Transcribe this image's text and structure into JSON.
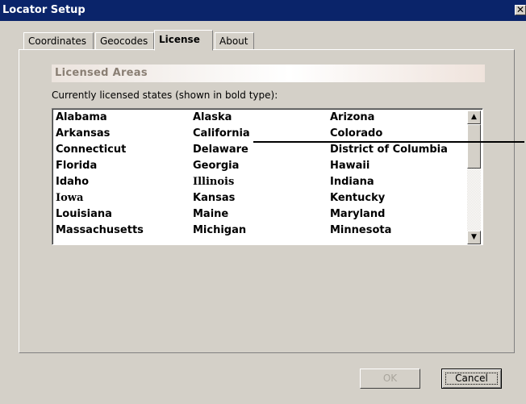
{
  "window": {
    "title": "Locator Setup",
    "close_glyph": "✕"
  },
  "tabs": [
    {
      "label": "Coordinates",
      "active": false
    },
    {
      "label": "Geocodes",
      "active": false
    },
    {
      "label": "License",
      "active": true
    },
    {
      "label": "About",
      "active": false
    }
  ],
  "section": {
    "header": "Licensed Areas",
    "description": "Currently licensed states (shown in bold type):"
  },
  "states": {
    "rows": [
      [
        "Alabama",
        "Alaska",
        "Arizona"
      ],
      [
        "Arkansas",
        "California",
        "Colorado"
      ],
      [
        "Connecticut",
        "Delaware",
        "District of Columbia"
      ],
      [
        "Florida",
        "Georgia",
        "Hawaii"
      ],
      [
        "Idaho",
        "Illinois",
        "Indiana"
      ],
      [
        "Iowa",
        "Kansas",
        "Kentucky"
      ],
      [
        "Louisiana",
        "Maine",
        "Maryland"
      ],
      [
        "Massachusetts",
        "Michigan",
        "Minnesota"
      ]
    ]
  },
  "scrollbar": {
    "up_glyph": "▲",
    "down_glyph": "▼"
  },
  "buttons": {
    "ok": "OK",
    "cancel": "Cancel"
  },
  "colors": {
    "titlebar": "#0a246a",
    "face": "#d4d0c8",
    "disabled_text": "#a9a59c"
  }
}
